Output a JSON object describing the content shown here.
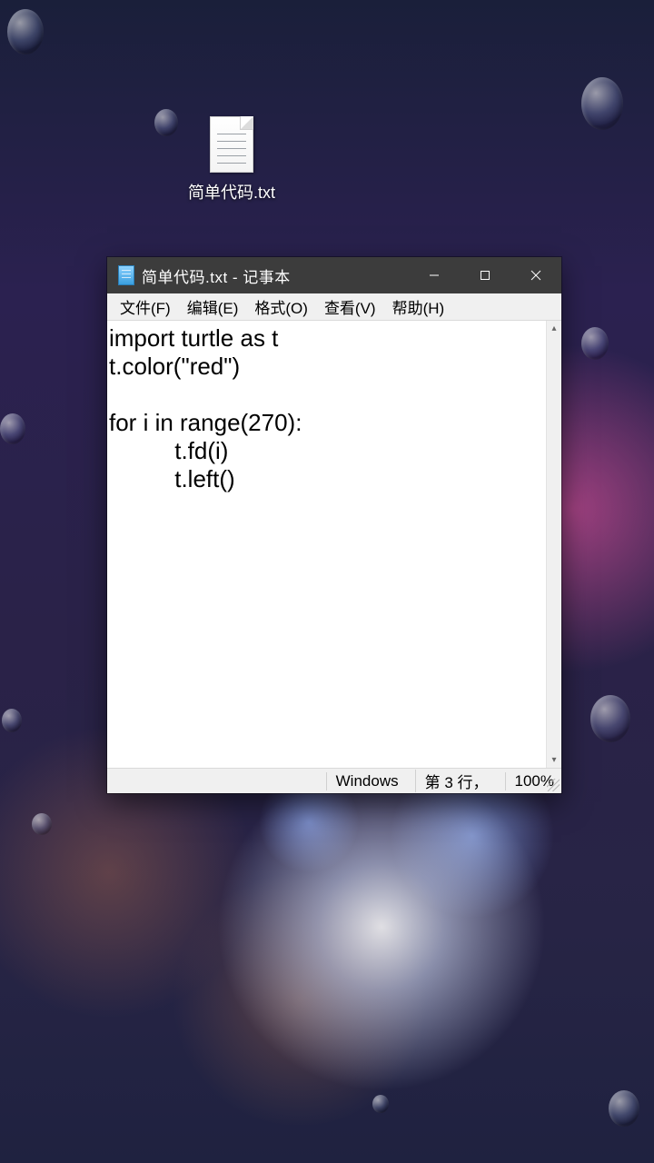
{
  "desktop": {
    "file_icon": {
      "label": "简单代码.txt"
    }
  },
  "window": {
    "title": "简单代码.txt - 记事本",
    "menu": {
      "file": "文件(F)",
      "edit": "编辑(E)",
      "format": "格式(O)",
      "view": "查看(V)",
      "help": "帮助(H)"
    },
    "editor_text": "import turtle as t\nt.color(\"red\")\n\nfor i in range(270):\n          t.fd(i)\n          t.left()",
    "status": {
      "platform": "Windows",
      "caret": "第 3 行，",
      "zoom": "100%"
    }
  }
}
